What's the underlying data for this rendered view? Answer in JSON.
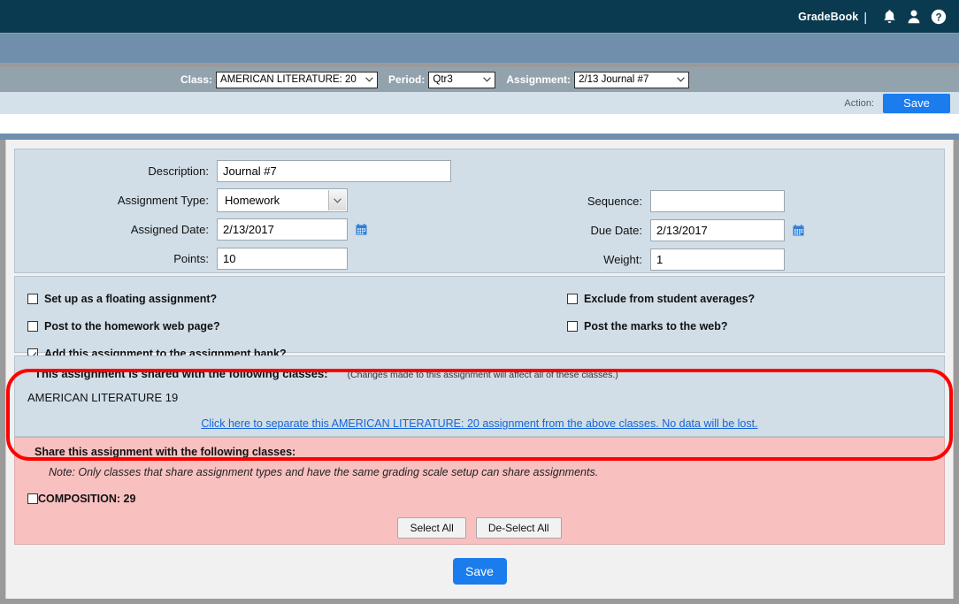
{
  "topbar": {
    "brand": "GradeBook",
    "separator": "|",
    "icons": [
      "bell-icon",
      "user-icon",
      "help-icon"
    ]
  },
  "selector_bar": {
    "class": {
      "label": "Class:",
      "value": "AMERICAN LITERATURE: 20"
    },
    "period": {
      "label": "Period:",
      "value": "Qtr3"
    },
    "assignment": {
      "label": "Assignment:",
      "value": "2/13 Journal #7"
    }
  },
  "action_bar": {
    "label": "Action:",
    "save_label": "Save"
  },
  "form": {
    "description": {
      "label": "Description:",
      "value": "Journal #7",
      "placeholder": ""
    },
    "assignment_type": {
      "label": "Assignment Type:",
      "value": "Homework"
    },
    "assigned_date": {
      "label": "Assigned Date:",
      "value": "2/13/2017"
    },
    "points": {
      "label": "Points:",
      "value": "10"
    },
    "sequence": {
      "label": "Sequence:",
      "value": "",
      "placeholder": ""
    },
    "due_date": {
      "label": "Due Date:",
      "value": "2/13/2017"
    },
    "weight": {
      "label": "Weight:",
      "value": "1"
    }
  },
  "options": {
    "left": [
      {
        "label": "Set up as a floating assignment?",
        "checked": false
      },
      {
        "label": "Post to the homework web page?",
        "checked": false
      },
      {
        "label": "Add this assignment to the assignment bank?",
        "checked": true
      }
    ],
    "right": [
      {
        "label": "Exclude from student averages?",
        "checked": false
      },
      {
        "label": "Post the marks to the web?",
        "checked": false
      }
    ]
  },
  "shared": {
    "title": "This assignment is shared with the following classes:",
    "note": "(Changes made to this assignment will affect all of these classes.)",
    "classes": [
      "AMERICAN LITERATURE 19"
    ],
    "separate_link": "Click here to separate this AMERICAN LITERATURE: 20 assignment from the above classes. No data will be lost."
  },
  "share": {
    "title": "Share this assignment with the following classes:",
    "note": "Note: Only classes that share assignment types and have the same grading scale setup can share assignments.",
    "classes": [
      {
        "label": "COMPOSITION: 29",
        "checked": false
      }
    ],
    "select_all_label": "Select All",
    "deselect_all_label": "De-Select All"
  },
  "footer": {
    "save_label": "Save"
  },
  "colors": {
    "topbar": "#0a3a50",
    "steel_band": "#6f8fad",
    "selector_band": "#93a3ad",
    "action_band": "#d4e0ea",
    "panel": "#d1dee8",
    "share_panel": "#f9c0c0",
    "accent_button": "#1b7ced",
    "link": "#1565d8",
    "annotation": "#ff0000"
  }
}
